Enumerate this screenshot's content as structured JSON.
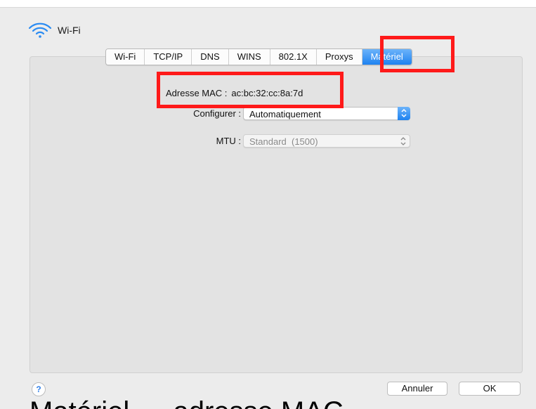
{
  "header": {
    "title": "Wi-Fi",
    "icon": "wifi-icon"
  },
  "tabs": [
    {
      "label": "Wi-Fi"
    },
    {
      "label": "TCP/IP"
    },
    {
      "label": "DNS"
    },
    {
      "label": "WINS"
    },
    {
      "label": "802.1X"
    },
    {
      "label": "Proxys"
    },
    {
      "label": "Matériel",
      "selected": true
    }
  ],
  "hardware": {
    "mac_label": "Adresse MAC :",
    "mac_value": "ac:bc:32:cc:8a:7d",
    "configure_label": "Configurer :",
    "configure_value": "Automatiquement",
    "mtu_label": "MTU :",
    "mtu_value": "Standard  (1500)"
  },
  "footer": {
    "help": "?",
    "cancel_label": "Annuler",
    "ok_label": "OK"
  },
  "caption": "Matériel → adresse MAC",
  "colors": {
    "accent": "#1e82f0",
    "highlight": "#ff1a1a"
  }
}
